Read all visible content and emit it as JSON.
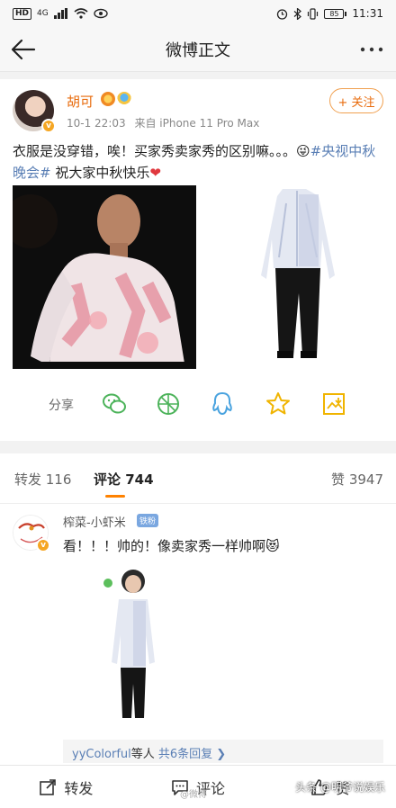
{
  "status_bar": {
    "network": "HD",
    "signal": "4G",
    "battery": "85",
    "time": "11:31"
  },
  "nav": {
    "title": "微博正文",
    "back_icon": "back-arrow-icon",
    "more_icon": "more-dots-icon"
  },
  "post": {
    "author": "胡可",
    "time": "10-1 22:03",
    "source": "来自 iPhone 11 Pro Max",
    "follow_label": "+ 关注",
    "text_line1": "衣服是没穿错，唉！买家秀卖家秀的区别嘛。。。😜",
    "topic": "#央视中秋晚会#",
    "text_rest": " 祝大家中秋快乐",
    "heart": "❤",
    "share_label": "分享"
  },
  "tabs": {
    "repost": "转发 116",
    "comment": "评论 744",
    "like": "赞 3947"
  },
  "comment": {
    "author": "榨菜-小虾米",
    "fan_badge": "铁粉",
    "text": "看！！！帅的！像卖家秀一样帅啊😻",
    "reply_user": "yyColorful",
    "reply_mid": "等人 ",
    "reply_count": "共6条回复 ❯"
  },
  "bottom_bar": {
    "repost": "转发",
    "comment": "评论",
    "like": "赞"
  },
  "watermark": "头条 @明爷说娱乐",
  "watermark2": "@微博"
}
